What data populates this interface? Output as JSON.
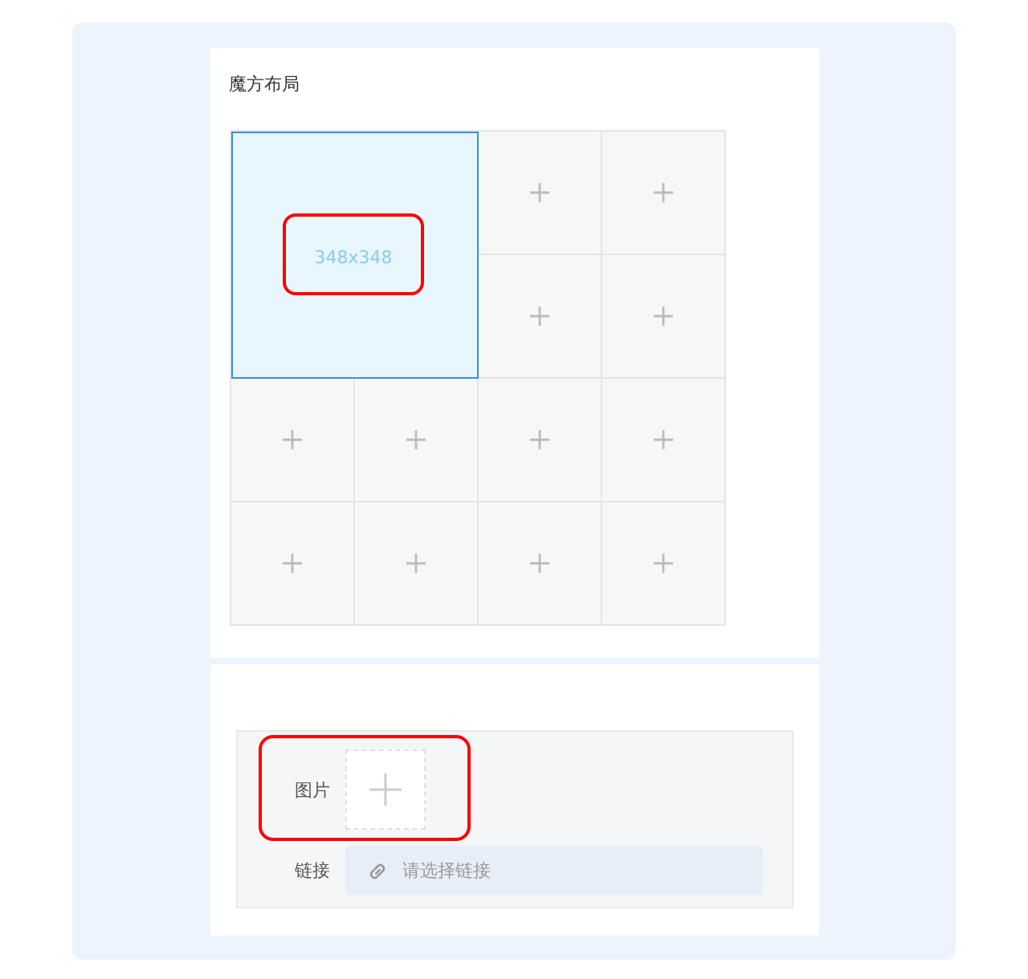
{
  "section_title": "魔方布局",
  "grid": {
    "cells": [
      {
        "kind": "block",
        "selected": true,
        "size": "348x348",
        "highlighted": true
      },
      {
        "kind": "add",
        "selected": false
      },
      {
        "kind": "add",
        "selected": false
      },
      {
        "kind": "add",
        "selected": false
      },
      {
        "kind": "add",
        "selected": false
      },
      {
        "kind": "add",
        "selected": false
      },
      {
        "kind": "add",
        "selected": false
      },
      {
        "kind": "add",
        "selected": false
      },
      {
        "kind": "add",
        "selected": false
      },
      {
        "kind": "add",
        "selected": false
      },
      {
        "kind": "add",
        "selected": false
      },
      {
        "kind": "add",
        "selected": false
      },
      {
        "kind": "add",
        "selected": false
      }
    ]
  },
  "form": {
    "image": {
      "label": "图片",
      "highlighted": true
    },
    "link": {
      "label": "链接",
      "placeholder": "请选择链接"
    }
  }
}
